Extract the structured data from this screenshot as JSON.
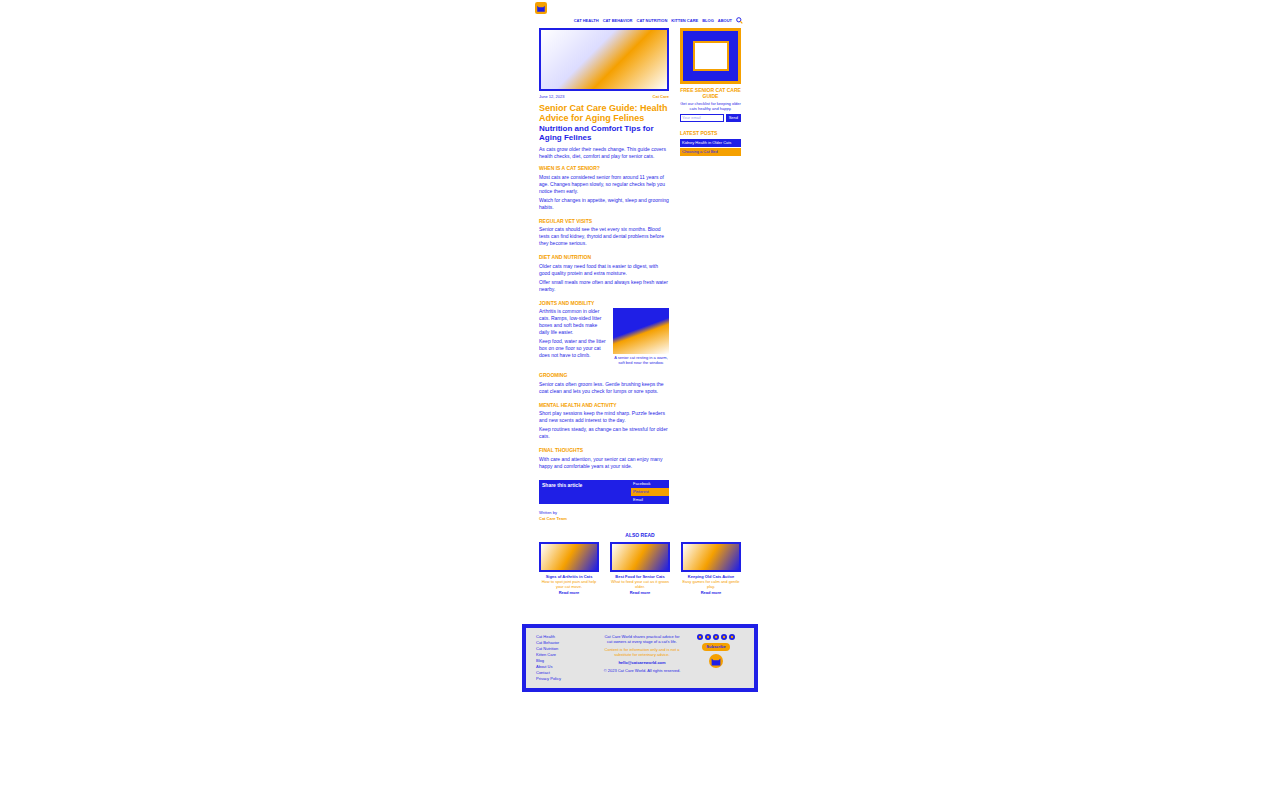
{
  "nav": [
    "CAT HEALTH",
    "CAT BEHAVIOR",
    "CAT NUTRITION",
    "KITTEN CARE",
    "BLOG",
    "ABOUT"
  ],
  "article": {
    "date": "June 12, 2023",
    "category": "Cat Care",
    "title": "Senior Cat Care Guide: Health Advice for Aging Felines",
    "subtitle": "Nutrition and Comfort Tips for Aging Felines",
    "lead": "As cats grow older their needs change. This guide covers health checks, diet, comfort and play for senior cats.",
    "sections": [
      {
        "heading": "WHEN IS A CAT SENIOR?",
        "paragraphs": [
          "Most cats are considered senior from around 11 years of age. Changes happen slowly, so regular checks help you notice them early.",
          "Watch for changes in appetite, weight, sleep and grooming habits."
        ]
      },
      {
        "heading": "REGULAR VET VISITS",
        "paragraphs": [
          "Senior cats should see the vet every six months. Blood tests can find kidney, thyroid and dental problems before they become serious."
        ]
      },
      {
        "heading": "DIET AND NUTRITION",
        "paragraphs": [
          "Older cats may need food that is easier to digest, with good quality protein and extra moisture.",
          "Offer small meals more often and always keep fresh water nearby."
        ]
      },
      {
        "heading": "JOINTS AND MOBILITY",
        "paragraphs": [
          "Arthritis is common in older cats. Ramps, low-sided litter boxes and soft beds make daily life easier.",
          "Keep food, water and the litter box on one floor so your cat does not have to climb."
        ]
      },
      {
        "heading": "GROOMING",
        "paragraphs": [
          "Senior cats often groom less. Gentle brushing keeps the coat clean and lets you check for lumps or sore spots."
        ]
      },
      {
        "heading": "MENTAL HEALTH AND ACTIVITY",
        "paragraphs": [
          "Short play sessions keep the mind sharp. Puzzle feeders and new scents add interest to the day.",
          "Keep routines steady, as change can be stressful for older cats."
        ]
      },
      {
        "heading": "FINAL THOUGHTS",
        "paragraphs": [
          "With care and attention, your senior cat can enjoy many happy and comfortable years at your side."
        ]
      }
    ],
    "figure_caption": "A senior cat resting in a warm, soft bed near the window."
  },
  "share": {
    "label": "Share this article",
    "buttons": [
      "Facebook",
      "Pinterest",
      "Email"
    ]
  },
  "author": {
    "label": "Written by",
    "name": "Cat Care Team"
  },
  "sidebar": {
    "title": "FREE SENIOR CAT CARE GUIDE",
    "text": "Get our checklist for keeping older cats healthy and happy.",
    "placeholder": "Your email",
    "button": "Send",
    "latest_title": "LATEST POSTS",
    "latest": [
      "Kidney Health in Older Cats",
      "Choosing a Cat Bed"
    ]
  },
  "related": {
    "title": "ALSO READ",
    "items": [
      {
        "title": "Signs of Arthritis in Cats",
        "excerpt": "How to spot joint pain and help your cat move.",
        "link": "Read more"
      },
      {
        "title": "Best Food for Senior Cats",
        "excerpt": "What to feed your cat as it grows older.",
        "link": "Read more"
      },
      {
        "title": "Keeping Old Cats Active",
        "excerpt": "Easy games for calm and gentle play.",
        "link": "Read more"
      }
    ]
  },
  "footer": {
    "links": [
      "Cat Health",
      "Cat Behavior",
      "Cat Nutrition",
      "Kitten Care",
      "Blog",
      "About Us",
      "Contact",
      "Privacy Policy"
    ],
    "about": "Cat Care World shares practical advice for cat owners at every stage of a cat's life.",
    "note": "Content is for information only and is not a substitute for veterinary advice.",
    "contact": "hello@catcareworld.com",
    "button": "Subscribe",
    "copyright": "© 2023 Cat Care World. All rights reserved."
  }
}
